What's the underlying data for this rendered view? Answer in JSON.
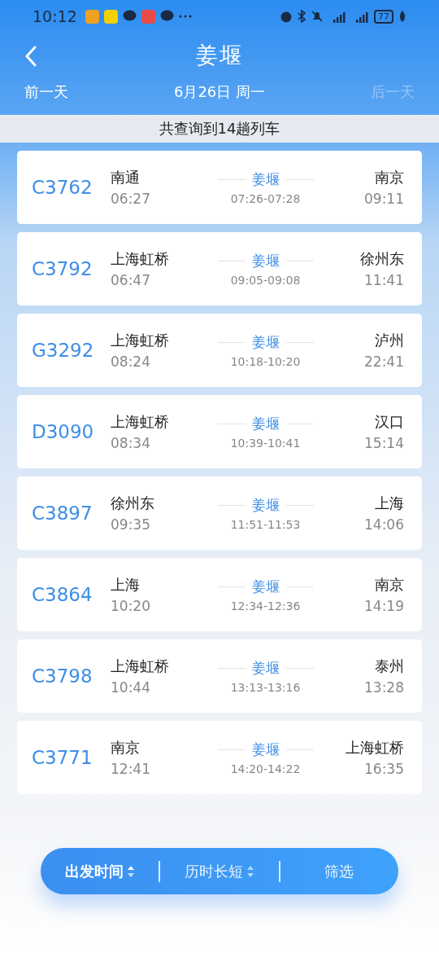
{
  "status_bar": {
    "time": "10:12",
    "battery": "77"
  },
  "header": {
    "title": "姜堰",
    "prev_day": {
      "label": "前一天",
      "disabled": false
    },
    "date": "6月26日 周一",
    "next_day": {
      "label": "后一天",
      "disabled": true
    }
  },
  "result_count": "共查询到14趟列车",
  "trains": [
    {
      "number": "C3762",
      "from": "南通",
      "depart": "06:27",
      "via": "姜堰",
      "via_times": "07:26-07:28",
      "to": "南京",
      "arrive": "09:11"
    },
    {
      "number": "C3792",
      "from": "上海虹桥",
      "depart": "06:47",
      "via": "姜堰",
      "via_times": "09:05-09:08",
      "to": "徐州东",
      "arrive": "11:41"
    },
    {
      "number": "G3292",
      "from": "上海虹桥",
      "depart": "08:24",
      "via": "姜堰",
      "via_times": "10:18-10:20",
      "to": "泸州",
      "arrive": "22:41"
    },
    {
      "number": "D3090",
      "from": "上海虹桥",
      "depart": "08:34",
      "via": "姜堰",
      "via_times": "10:39-10:41",
      "to": "汉口",
      "arrive": "15:14"
    },
    {
      "number": "C3897",
      "from": "徐州东",
      "depart": "09:35",
      "via": "姜堰",
      "via_times": "11:51-11:53",
      "to": "上海",
      "arrive": "14:06"
    },
    {
      "number": "C3864",
      "from": "上海",
      "depart": "10:20",
      "via": "姜堰",
      "via_times": "12:34-12:36",
      "to": "南京",
      "arrive": "14:19"
    },
    {
      "number": "C3798",
      "from": "上海虹桥",
      "depart": "10:44",
      "via": "姜堰",
      "via_times": "13:13-13:16",
      "to": "泰州",
      "arrive": "13:28"
    },
    {
      "number": "C3771",
      "from": "南京",
      "depart": "12:41",
      "via": "姜堰",
      "via_times": "14:20-14:22",
      "to": "上海虹桥",
      "arrive": "16:35"
    }
  ],
  "bottom_bar": [
    {
      "kind": "sort",
      "label": "出发时间",
      "selected": true
    },
    {
      "kind": "sort",
      "label": "历时长短",
      "selected": false
    },
    {
      "kind": "filter",
      "label": "筛选",
      "selected": false
    }
  ]
}
